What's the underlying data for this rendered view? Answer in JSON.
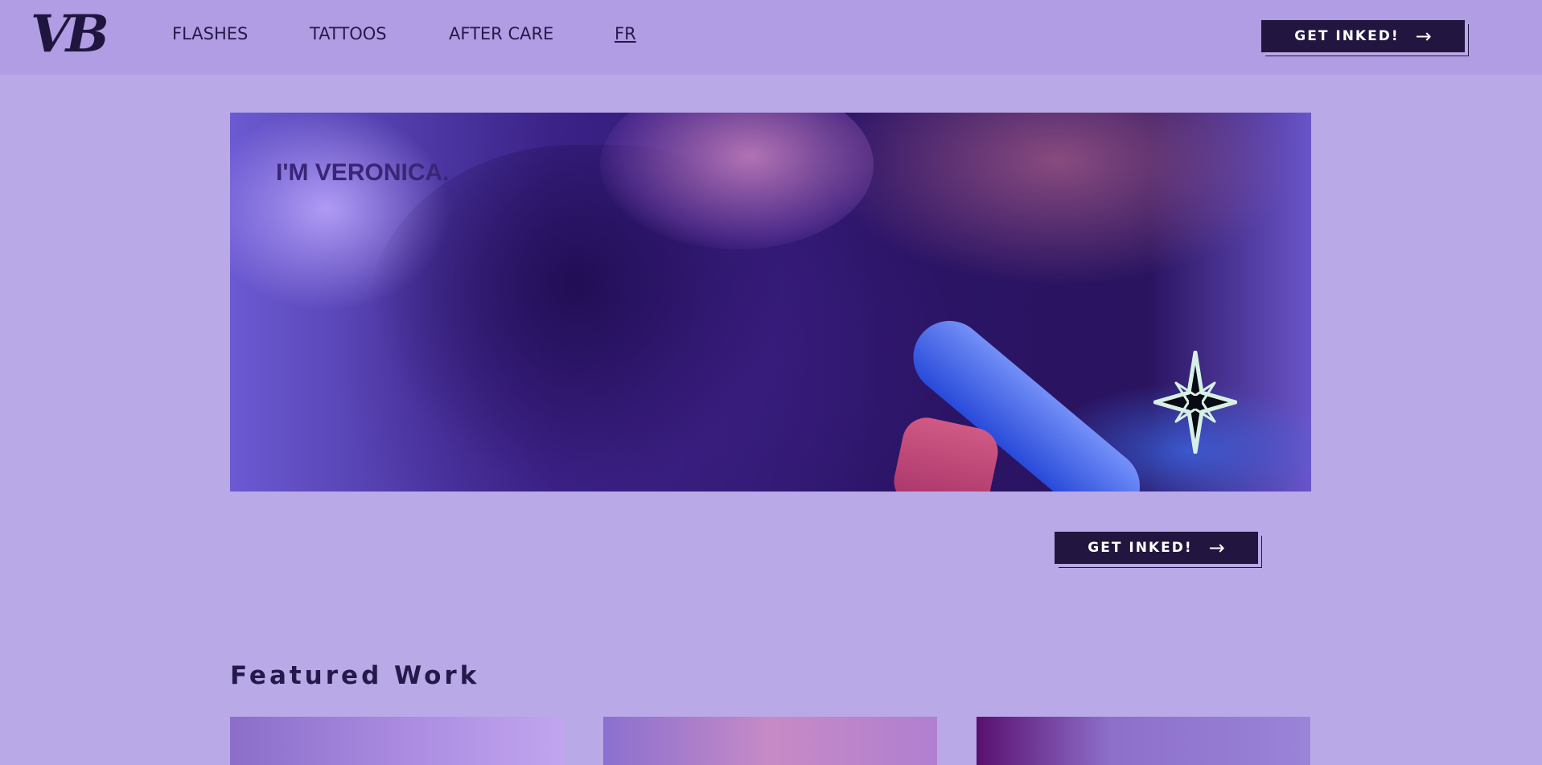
{
  "header": {
    "logo_text": "VB",
    "nav": [
      {
        "label": "FLASHES"
      },
      {
        "label": "TATTOOS"
      },
      {
        "label": "AFTER CARE"
      },
      {
        "label": "FR"
      }
    ],
    "cta_label": "GET INKED!",
    "cta_icon": "arrow-right-icon"
  },
  "hero": {
    "title": "I'M VERONICA.",
    "star_icon": "sparkle-star-icon",
    "cta_label": "GET INKED!",
    "cta_icon": "arrow-right-icon"
  },
  "featured": {
    "title": "Featured Work",
    "cards": [
      {
        "name": "featured-work-1"
      },
      {
        "name": "featured-work-2"
      },
      {
        "name": "featured-work-3"
      }
    ]
  },
  "colors": {
    "page_bg": "#b9a9e7",
    "header_bg": "#b19de3",
    "button_bg": "#221640",
    "button_text": "#ffffff",
    "text_dark": "#23194a"
  }
}
